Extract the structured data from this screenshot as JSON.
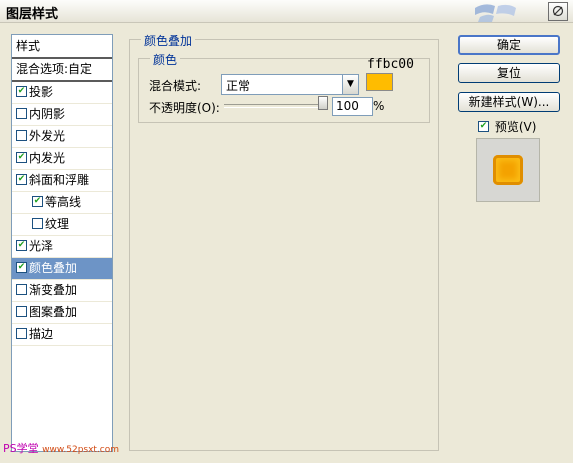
{
  "window": {
    "title": "图层样式"
  },
  "sidebar": {
    "header": "样式",
    "blend_options": "混合选项:自定",
    "items": [
      {
        "label": "投影",
        "checked": true
      },
      {
        "label": "内阴影",
        "checked": false
      },
      {
        "label": "外发光",
        "checked": false
      },
      {
        "label": "内发光",
        "checked": true
      },
      {
        "label": "斜面和浮雕",
        "checked": true
      },
      {
        "label": "等高线",
        "checked": true
      },
      {
        "label": "纹理",
        "checked": false
      },
      {
        "label": "光泽",
        "checked": true
      },
      {
        "label": "颜色叠加",
        "checked": true
      },
      {
        "label": "渐变叠加",
        "checked": false
      },
      {
        "label": "图案叠加",
        "checked": false
      },
      {
        "label": "描边",
        "checked": false
      }
    ]
  },
  "panel": {
    "group_title": "颜色叠加",
    "subgroup_title": "颜色",
    "blend_mode_label": "混合模式:",
    "blend_mode_value": "正常",
    "opacity_label": "不透明度(O):",
    "opacity_value": "100",
    "opacity_unit": "%",
    "opacity_level": 1.0,
    "color_hex_label": "ffbc00",
    "color": "#ffbc00"
  },
  "buttons": {
    "ok": "确定",
    "reset": "复位",
    "new_style": "新建样式(W)...",
    "preview_label": "预览(V)"
  },
  "watermark": {
    "text": "PS学堂",
    "url": "www.52psxt.com"
  }
}
